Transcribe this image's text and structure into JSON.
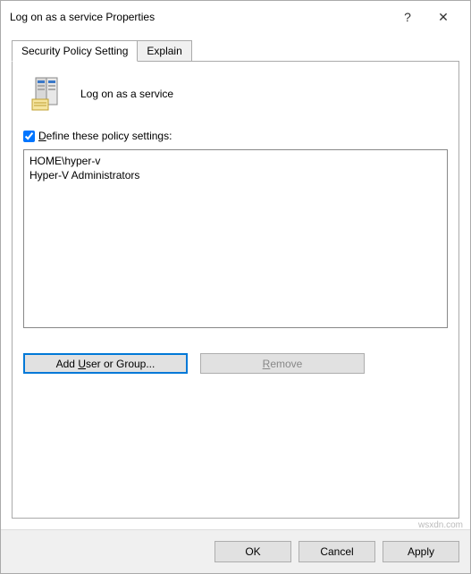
{
  "titlebar": {
    "title": "Log on as a service Properties",
    "help": "?",
    "close": "✕"
  },
  "tabs": {
    "security": "Security Policy Setting",
    "explain": "Explain"
  },
  "panel": {
    "policy_title": "Log on as a service",
    "checkbox_label_pre": "D",
    "checkbox_label_post": "efine these policy settings:",
    "entries": [
      "HOME\\hyper-v",
      "Hyper-V Administrators"
    ],
    "add_button_pre": "Add ",
    "add_button_u": "U",
    "add_button_post": "ser or Group...",
    "remove_button_pre": "",
    "remove_button_u": "R",
    "remove_button_post": "emove"
  },
  "dialog": {
    "ok": "OK",
    "cancel": "Cancel",
    "apply": "Apply"
  },
  "watermark": "wsxdn.com"
}
